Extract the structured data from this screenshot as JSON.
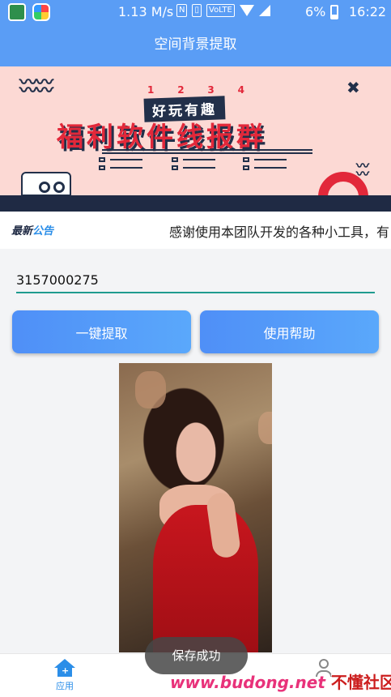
{
  "status_bar": {
    "net_speed": "1.13 M/s",
    "nfc_label": "N",
    "volte_label": "VoLTE",
    "battery": "6%",
    "time": "16:22"
  },
  "app_bar": {
    "title": "空间背景提取"
  },
  "banner": {
    "numbers": [
      "1",
      "2",
      "3",
      "4"
    ],
    "tag": "好玩有趣",
    "headline": "福利软件线报群",
    "x_mark": "✖"
  },
  "notice": {
    "logo_prefix": "最新",
    "logo_suffix": "公告",
    "text": "感谢使用本团队开发的各种小工具，有"
  },
  "form": {
    "qq_value": "3157000275"
  },
  "buttons": {
    "extract": "一键提取",
    "help": "使用帮助"
  },
  "toast": "保存成功",
  "bottom_nav": {
    "app_label": "应用",
    "home_icon": "home-icon",
    "user_icon": "user-icon"
  },
  "watermark": {
    "site": "www.budong.net",
    "brand": "不懂社区"
  },
  "colors": {
    "primary": "#5a9df5",
    "accent": "#2b8ee8",
    "input_line": "#1f9b8f"
  }
}
